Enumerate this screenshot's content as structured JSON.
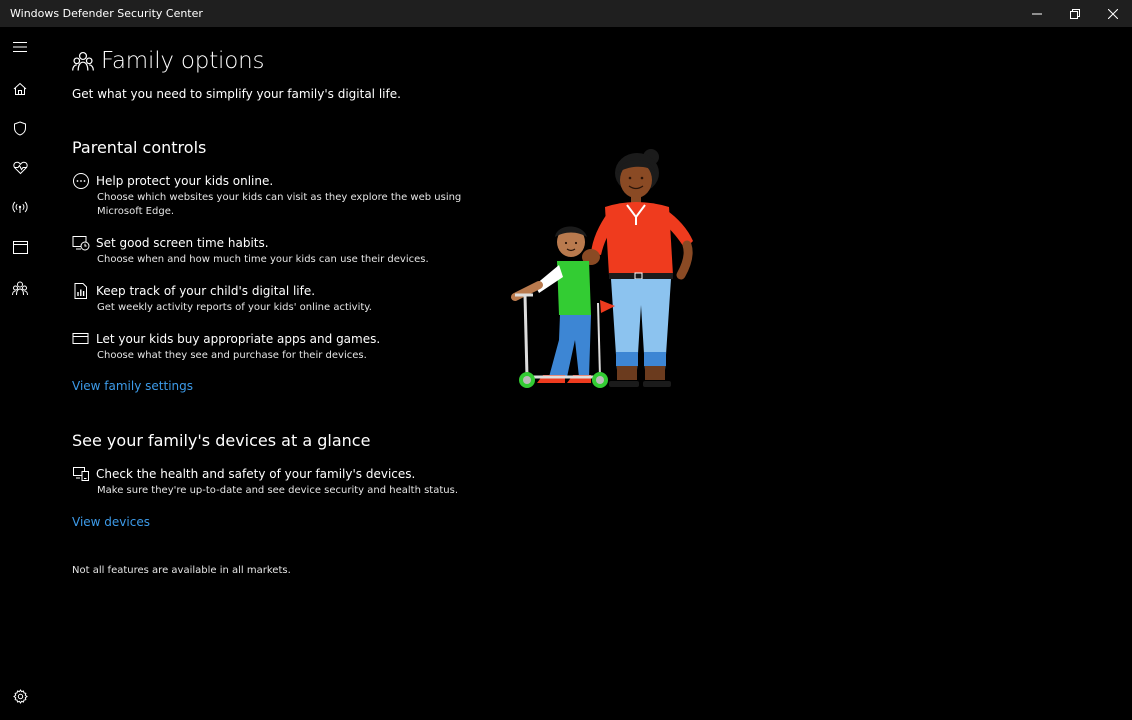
{
  "window": {
    "title": "Windows Defender Security Center",
    "controls": [
      "minimize-icon",
      "restore-icon",
      "close-icon"
    ]
  },
  "sidebar": {
    "items": [
      {
        "icon": "hamburger-menu-icon"
      },
      {
        "icon": "home-icon"
      },
      {
        "icon": "shield-icon"
      },
      {
        "icon": "heart-pulse-icon"
      },
      {
        "icon": "wireless-icon"
      },
      {
        "icon": "app-browser-icon"
      },
      {
        "icon": "family-icon"
      }
    ],
    "footer_icon": "gear-icon"
  },
  "main": {
    "title": "Family options",
    "title_icon": "family-icon",
    "subtitle": "Get what you need to simplify your family's digital life.",
    "parental": {
      "heading": "Parental controls",
      "features": [
        {
          "icon": "web-filter-icon",
          "title": "Help protect your kids online.",
          "desc": "Choose which websites your kids can visit as they explore the web using Microsoft Edge."
        },
        {
          "icon": "screen-time-icon",
          "title": "Set good screen time habits.",
          "desc": "Choose when and how much time your kids can use their devices."
        },
        {
          "icon": "activity-report-icon",
          "title": "Keep track of your child's digital life.",
          "desc": "Get weekly activity reports of your kids' online activity."
        },
        {
          "icon": "purchase-card-icon",
          "title": "Let your kids buy appropriate apps and games.",
          "desc": "Choose what they see and purchase for their devices."
        }
      ],
      "link": "View family settings"
    },
    "devices": {
      "heading": "See your family's devices at a glance",
      "features": [
        {
          "icon": "devices-icon",
          "title": "Check the health and safety of your family's devices.",
          "desc": "Make sure they're up-to-date and see device security and health status."
        }
      ],
      "link": "View devices"
    },
    "note": "Not all features are available in all markets."
  },
  "colors": {
    "background": "#000000",
    "titlebar": "#1f1f1f",
    "link": "#3d9be9"
  }
}
